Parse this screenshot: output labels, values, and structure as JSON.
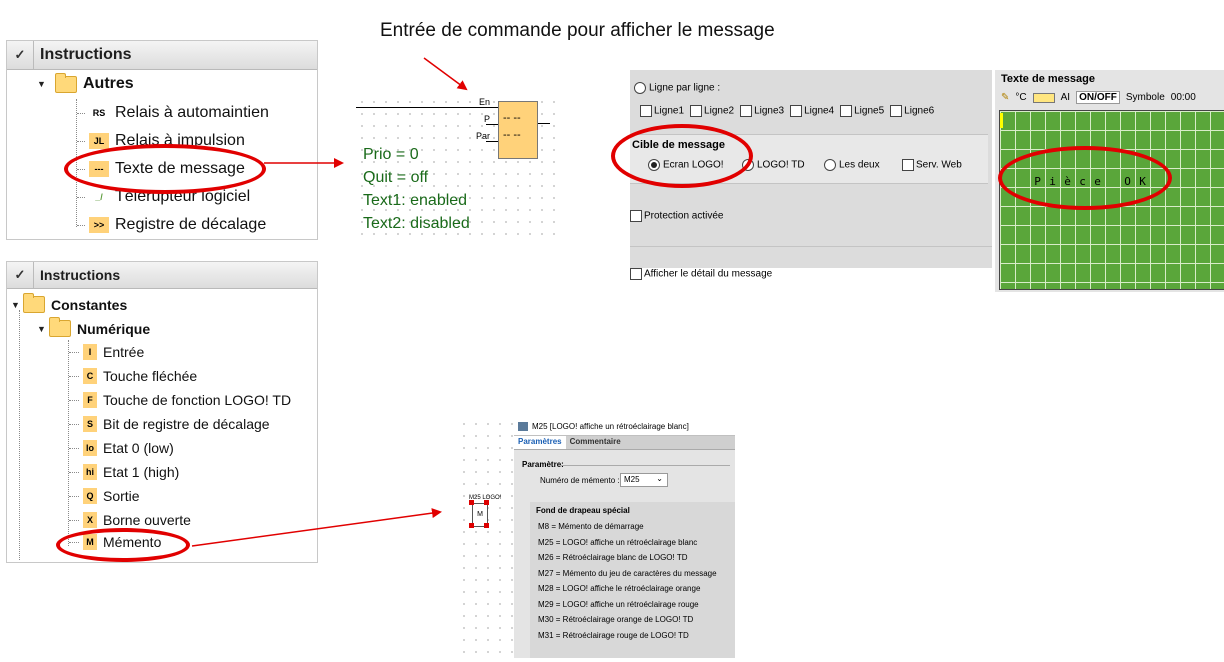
{
  "caption": "Entrée de commande pour afficher le message",
  "tree1": {
    "header": "Instructions",
    "folder": "Autres",
    "items": [
      {
        "badge": "RS",
        "label": "Relais à automaintien"
      },
      {
        "badge": "JL",
        "label": "Relais à impulsion"
      },
      {
        "badge": "---",
        "label": "Texte de message"
      },
      {
        "badge": "_/",
        "label": "Télérupteur logiciel"
      },
      {
        "badge": ">>",
        "label": "Registre de décalage"
      }
    ]
  },
  "tree2": {
    "header": "Instructions",
    "folder1": "Constantes",
    "folder2": "Numérique",
    "items": [
      {
        "badge": "I",
        "label": "Entrée"
      },
      {
        "badge": "C",
        "label": "Touche fléchée"
      },
      {
        "badge": "F",
        "label": "Touche de fonction LOGO! TD"
      },
      {
        "badge": "S",
        "label": "Bit de registre de décalage"
      },
      {
        "badge": "lo",
        "label": "Etat 0 (low)"
      },
      {
        "badge": "hi",
        "label": "Etat 1 (high)"
      },
      {
        "badge": "Q",
        "label": "Sortie"
      },
      {
        "badge": "X",
        "label": "Borne ouverte"
      },
      {
        "badge": "M",
        "label": "Mémento"
      }
    ]
  },
  "block": {
    "pin_en": "En",
    "pin_p": "P",
    "pin_par": "Par",
    "dashes": "-- --",
    "params": [
      "Prio = 0",
      "Quit = off",
      "Text1: enabled",
      "Text2: disabled"
    ]
  },
  "message_config": {
    "line_mode": "Ligne par ligne :",
    "lines": [
      "Ligne1",
      "Ligne2",
      "Ligne3",
      "Ligne4",
      "Ligne5",
      "Ligne6"
    ],
    "target_title": "Cible de message",
    "targets": [
      "Ecran LOGO!",
      "LOGO! TD",
      "Les deux"
    ],
    "web": "Serv. Web",
    "protection": "Protection activée",
    "detail": "Afficher le détail du message"
  },
  "message_text": {
    "title": "Texte de message",
    "toolbar": [
      "°C",
      "AI",
      "ON/OFF",
      "Symbole",
      "00:00"
    ],
    "chars": [
      "P",
      "i",
      "è",
      "c",
      "e",
      "",
      "O",
      "K"
    ]
  },
  "dialog": {
    "title": "M25 [LOGO! affiche un rétroéclairage blanc]",
    "tabs": [
      "Paramètres",
      "Commentaire"
    ],
    "section": "Paramètre:",
    "field_label": "Numéro de mémento :",
    "field_value": "M25",
    "flags_title": "Fond de drapeau spécial",
    "flags": [
      "M8 = Mémento de démarrage",
      "M25 = LOGO! affiche un rétroéclairage blanc",
      "M26 = Rétroéclairage blanc de LOGO! TD",
      "M27 = Mémento du jeu de caractères du message",
      "M28 = LOGO! affiche le rétroéclairage orange",
      "M29 = LOGO! affiche un rétroéclairage rouge",
      "M30 = Rétroéclairage orange de LOGO! TD",
      "M31 = Rétroéclairage rouge de LOGO! TD"
    ],
    "block_label": "M25 LOGO!",
    "block_text": "M"
  },
  "colors": {
    "accent_red": "#e10000",
    "lcd_green": "#5aa63a",
    "badge_yellow": "#ffd27a",
    "block_fill": "#ffd27a"
  }
}
